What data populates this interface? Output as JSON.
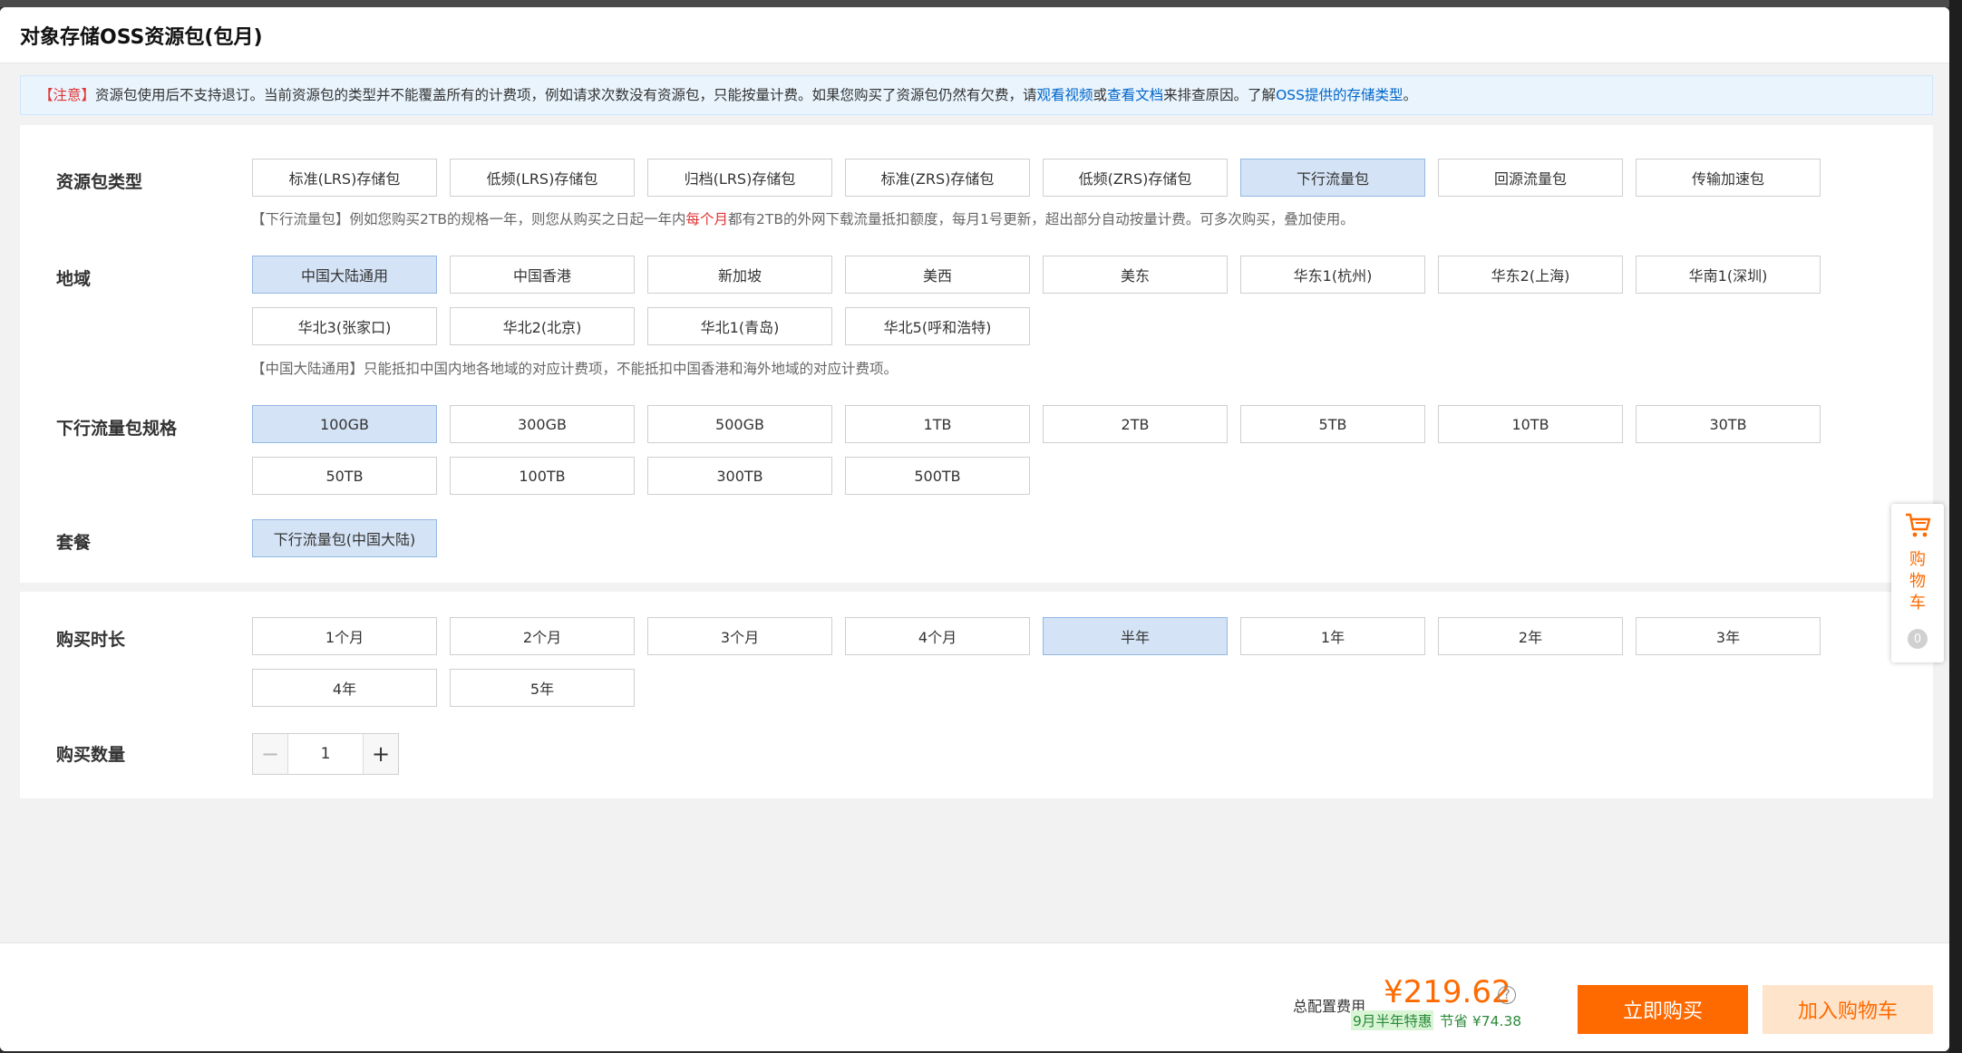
{
  "dialog": {
    "title": "对象存储OSS资源包(包月)"
  },
  "notice": {
    "warn": "【注意】",
    "text1": "资源包使用后不支持退订。当前资源包的类型并不能覆盖所有的计费项，例如请求次数没有资源包，只能按量计费。如果您购买了资源包仍然有欠费，请",
    "link1": "观看视频",
    "or": "或",
    "link2": "查看文档",
    "text2": "来排查原因。了解",
    "link3": "OSS提供的存储类型",
    "end": "。"
  },
  "package_type": {
    "label": "资源包类型",
    "options": [
      "标准(LRS)存储包",
      "低频(LRS)存储包",
      "归档(LRS)存储包",
      "标准(ZRS)存储包",
      "低频(ZRS)存储包",
      "下行流量包",
      "回源流量包",
      "传输加速包"
    ],
    "selected": "下行流量包",
    "hint_pre": "【下行流量包】例如您购买2TB的规格一年，则您从购买之日起一年内",
    "hint_red": "每个月",
    "hint_post": "都有2TB的外网下载流量抵扣额度，每月1号更新，超出部分自动按量计费。可多次购买，叠加使用。"
  },
  "region": {
    "label": "地域",
    "options": [
      "中国大陆通用",
      "中国香港",
      "新加坡",
      "美西",
      "美东",
      "华东1(杭州)",
      "华东2(上海)",
      "华南1(深圳)",
      "华北3(张家口)",
      "华北2(北京)",
      "华北1(青岛)",
      "华北5(呼和浩特)"
    ],
    "selected": "中国大陆通用",
    "hint": "【中国大陆通用】只能抵扣中国内地各地域的对应计费项，不能抵扣中国香港和海外地域的对应计费项。"
  },
  "spec": {
    "label": "下行流量包规格",
    "options": [
      "100GB",
      "300GB",
      "500GB",
      "1TB",
      "2TB",
      "5TB",
      "10TB",
      "30TB",
      "50TB",
      "100TB",
      "300TB",
      "500TB"
    ],
    "selected": "100GB"
  },
  "plan": {
    "label": "套餐",
    "options": [
      "下行流量包(中国大陆)"
    ],
    "selected": "下行流量包(中国大陆)"
  },
  "duration": {
    "label": "购买时长",
    "options": [
      "1个月",
      "2个月",
      "3个月",
      "4个月",
      "半年",
      "1年",
      "2年",
      "3年",
      "4年",
      "5年"
    ],
    "selected": "半年"
  },
  "quantity": {
    "label": "购买数量",
    "value": "1",
    "minus": "−",
    "plus": "+"
  },
  "footer": {
    "cost_label": "总配置费用",
    "price": "¥219.62",
    "help": "?",
    "promo": "9月半年特惠",
    "save": "节省 ¥74.38",
    "buy_now": "立即购买",
    "add_cart": "加入购物车"
  },
  "cart_float": {
    "text": "购物车",
    "count": "0"
  },
  "colors": {
    "accent": "#ff6a00",
    "selected_bg": "#d4e3f5",
    "link": "#0066cc",
    "warn": "#e03535"
  }
}
